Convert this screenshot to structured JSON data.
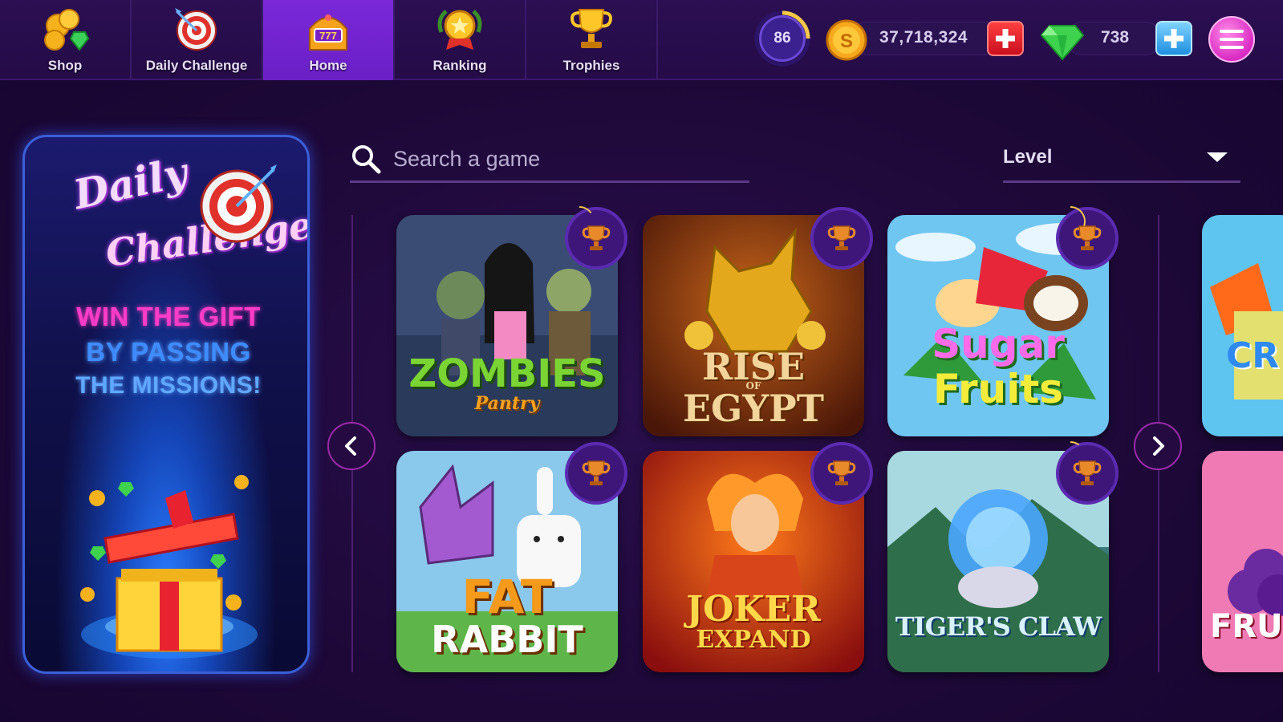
{
  "nav": {
    "tabs": [
      {
        "label": "Shop",
        "icon": "coins-gem-icon"
      },
      {
        "label": "Daily Challenge",
        "icon": "target-icon"
      },
      {
        "label": "Home",
        "icon": "slot-machine-icon",
        "active": true
      },
      {
        "label": "Ranking",
        "icon": "medal-icon"
      },
      {
        "label": "Trophies",
        "icon": "trophy-icon"
      }
    ]
  },
  "hud": {
    "level": "86",
    "coins": "37,718,324",
    "gems": "738"
  },
  "banner": {
    "title_line1": "Daily",
    "title_line2": "Challenge",
    "line1": "WIN THE GIFT",
    "line2": "BY PASSING",
    "line3": "THE MISSIONS!"
  },
  "search": {
    "placeholder": "Search a game"
  },
  "filter": {
    "selected": "Level"
  },
  "games": [
    {
      "title": "ZOMBIES",
      "subtitle": "Pantry",
      "progress": 0.15
    },
    {
      "title": "RISE",
      "subtitle": "OF",
      "title2": "EGYPT",
      "progress": 0.0
    },
    {
      "title": "Sugar",
      "title2": "Fruits",
      "progress": 0.3
    },
    {
      "title": "FAT",
      "title2": "RABBIT",
      "progress": 0.0
    },
    {
      "title": "JOKER",
      "title2": "EXPAND",
      "progress": 0.0
    },
    {
      "title": "TIGER'S CLAW",
      "progress": 0.1
    },
    {
      "title": "CR",
      "partial": true
    },
    {
      "title": "FRU",
      "partial": true
    }
  ],
  "colors": {
    "background": "#1d0837",
    "active_tab": "#6a1fc6",
    "badge_bg": "#3e167a",
    "progress_arc": "#f5c84a",
    "arrow_border": "#9b2aa9"
  }
}
